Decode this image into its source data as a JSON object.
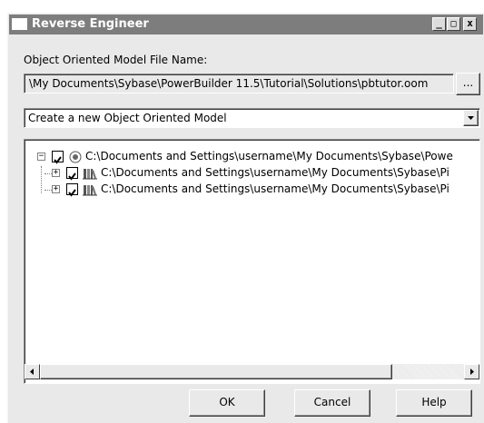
{
  "header_fragment": "",
  "window": {
    "title": "Reverse Engineer",
    "controls": {
      "minimize": "_",
      "maximize": "□",
      "close": "x"
    }
  },
  "file_section": {
    "label": "Object Oriented Model File Name:",
    "path_value": "\\My Documents\\Sybase\\PowerBuilder 11.5\\Tutorial\\Solutions\\pbtutor.oom",
    "browse_label": "..."
  },
  "mode_select": {
    "selected": "Create a new Object Oriented Model"
  },
  "tree": {
    "root": {
      "expander": "−",
      "checked": true,
      "icon": "target-radio-icon",
      "label": "C:\\Documents and Settings\\username\\My Documents\\Sybase\\Powe"
    },
    "children": [
      {
        "expander": "+",
        "checked": true,
        "icon": "library-books-icon",
        "label": "C:\\Documents and Settings\\username\\My Documents\\Sybase\\Pi"
      },
      {
        "expander": "+",
        "checked": true,
        "icon": "library-books-icon",
        "label": "C:\\Documents and Settings\\username\\My Documents\\Sybase\\Pi"
      }
    ]
  },
  "buttons": {
    "ok": "OK",
    "cancel": "Cancel",
    "help": "Help"
  },
  "colors": {
    "titlebar": "#7d7d7d",
    "dialog_bg": "#e9e9e9",
    "field_bg": "#ffffff"
  }
}
